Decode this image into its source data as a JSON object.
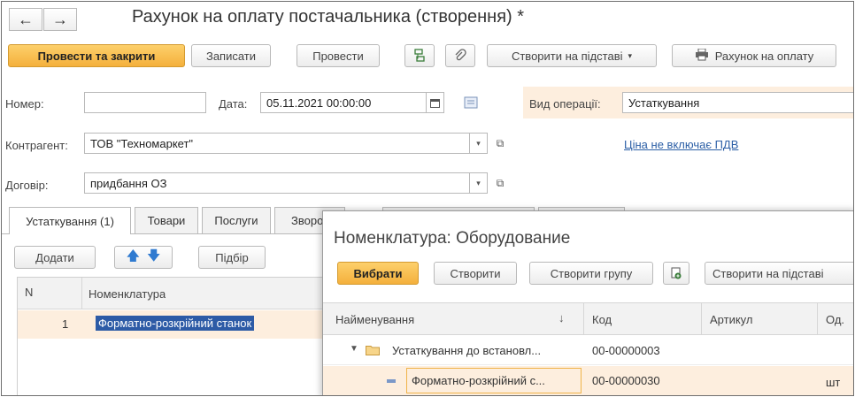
{
  "window": {
    "title": "Рахунок на оплату постачальника (створення) *"
  },
  "toolbar": {
    "post_close": "Провести та закрити",
    "save": "Записати",
    "post": "Провести",
    "create_basis": "Створити на підставі",
    "invoice_print": "Рахунок на оплату"
  },
  "form": {
    "number_label": "Номер:",
    "number_value": "",
    "date_label": "Дата:",
    "date_value": "05.11.2021 00:00:00",
    "operation_label": "Вид операції:",
    "operation_value": "Устаткування",
    "counterparty_label": "Контрагент:",
    "counterparty_value": "ТОВ \"Техномаркет\"",
    "contract_label": "Договір:",
    "contract_value": "придбання ОЗ",
    "vat_link": "Ціна не включає ПДВ"
  },
  "tabs": [
    {
      "label": "Устаткування (1)"
    },
    {
      "label": "Товари"
    },
    {
      "label": "Послуги"
    },
    {
      "label": "Зворот"
    }
  ],
  "table_toolbar": {
    "add": "Додати",
    "pick": "Підбір"
  },
  "table": {
    "col_n": "N",
    "col_item": "Номенклатура",
    "rows": [
      {
        "n": "1",
        "item": "Форматно-розкрійний станок"
      }
    ]
  },
  "popup": {
    "title": "Номенклатура: Оборудование",
    "select": "Вибрати",
    "create": "Створити",
    "create_group": "Створити групу",
    "create_basis": "Створити на підставі",
    "columns": {
      "name": "Найменування",
      "sort": "↓",
      "code": "Код",
      "article": "Артикул",
      "unit": "Од."
    },
    "rows": [
      {
        "name": "Устаткування до встановл...",
        "code": "00-00000003",
        "article": "",
        "unit": ""
      },
      {
        "name": "Форматно-розкрійний с...",
        "code": "00-00000030",
        "article": "",
        "unit": "шт"
      }
    ]
  },
  "colors": {
    "accent": "#f4b03c",
    "selection": "#fdeede",
    "link": "#2c5fa6"
  }
}
